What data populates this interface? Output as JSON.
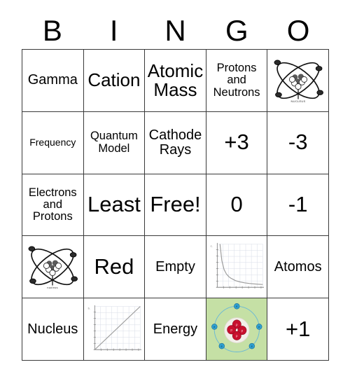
{
  "header": {
    "letters": [
      "B",
      "I",
      "N",
      "G",
      "O"
    ]
  },
  "colors": {
    "grid_line": "#3a3a3a",
    "text": "#000000",
    "tint_background": "#c5e0a5",
    "proton_red": "#c8102e",
    "electron_blue": "#2f9fd0",
    "plot_curve": "#9a9a9a",
    "plot_grid": "#d7dce6"
  },
  "card": {
    "rows": [
      [
        {
          "type": "text",
          "text": "Gamma",
          "size": "md",
          "name": "cell-gamma"
        },
        {
          "type": "text",
          "text": "Cation",
          "size": "lg",
          "name": "cell-cation"
        },
        {
          "type": "text",
          "text": "Atomic Mass",
          "size": "lg",
          "name": "cell-atomic-mass"
        },
        {
          "type": "text",
          "text": "Protons and Neutrons",
          "size": "sm",
          "name": "cell-protons-and-neutrons"
        },
        {
          "type": "atom",
          "label": "NUCLEUS",
          "name": "cell-atom-diagram-1"
        }
      ],
      [
        {
          "type": "text",
          "text": "Frequency",
          "size": "xs",
          "name": "cell-frequency"
        },
        {
          "type": "text",
          "text": "Quantum Model",
          "size": "sm",
          "name": "cell-quantum-model"
        },
        {
          "type": "text",
          "text": "Cathode Rays",
          "size": "md",
          "name": "cell-cathode-rays"
        },
        {
          "type": "text",
          "text": "+3",
          "size": "xl",
          "name": "cell-plus-3"
        },
        {
          "type": "text",
          "text": "-3",
          "size": "xl",
          "name": "cell-minus-3"
        }
      ],
      [
        {
          "type": "text",
          "text": "Electrons and Protons",
          "size": "sm",
          "name": "cell-electrons-and-protons"
        },
        {
          "type": "text",
          "text": "Least",
          "size": "xl",
          "name": "cell-least"
        },
        {
          "type": "text",
          "text": "Free!",
          "size": "xl",
          "name": "cell-free-space"
        },
        {
          "type": "text",
          "text": "0",
          "size": "xl",
          "name": "cell-zero"
        },
        {
          "type": "text",
          "text": "-1",
          "size": "xl",
          "name": "cell-minus-1"
        }
      ],
      [
        {
          "type": "atom",
          "label": "nucleus",
          "name": "cell-atom-diagram-2"
        },
        {
          "type": "text",
          "text": "Red",
          "size": "xl",
          "name": "cell-red"
        },
        {
          "type": "text",
          "text": "Empty",
          "size": "md",
          "name": "cell-empty"
        },
        {
          "type": "plot-inverse",
          "label": "c.",
          "name": "cell-inverse-curve-graph"
        },
        {
          "type": "text",
          "text": "Atomos",
          "size": "md",
          "name": "cell-atomos"
        }
      ],
      [
        {
          "type": "text",
          "text": "Nucleus",
          "size": "md",
          "name": "cell-nucleus"
        },
        {
          "type": "plot-linear",
          "label": "b.",
          "name": "cell-linear-graph"
        },
        {
          "type": "text",
          "text": "Energy",
          "size": "md",
          "name": "cell-energy"
        },
        {
          "type": "bohr",
          "proton_glyph": "p",
          "electron_glyph": "e",
          "name": "cell-bohr-model",
          "tinted": true
        },
        {
          "type": "text",
          "text": "+1",
          "size": "xl",
          "name": "cell-plus-1"
        }
      ]
    ]
  },
  "chart_data": [
    {
      "type": "line",
      "title": "",
      "annotation": "c.",
      "xlabel": "",
      "ylabel": "",
      "grid": true,
      "legend": "none",
      "xlim": [
        0,
        10
      ],
      "ylim": [
        0,
        10
      ],
      "x": [
        0.6,
        1,
        1.5,
        2,
        2.5,
        3,
        4,
        5,
        6,
        7,
        8,
        9,
        10
      ],
      "y": [
        10,
        6.2,
        4.1,
        3.1,
        2.5,
        2.1,
        1.55,
        1.25,
        1.05,
        0.9,
        0.8,
        0.72,
        0.65
      ],
      "description": "inverse decay curve"
    },
    {
      "type": "line",
      "title": "",
      "annotation": "b.",
      "xlabel": "",
      "ylabel": "",
      "grid": true,
      "legend": "none",
      "xlim": [
        0,
        10
      ],
      "ylim": [
        0,
        10
      ],
      "x": [
        0,
        10
      ],
      "y": [
        0,
        10
      ],
      "description": "straight proportional line through origin"
    }
  ]
}
